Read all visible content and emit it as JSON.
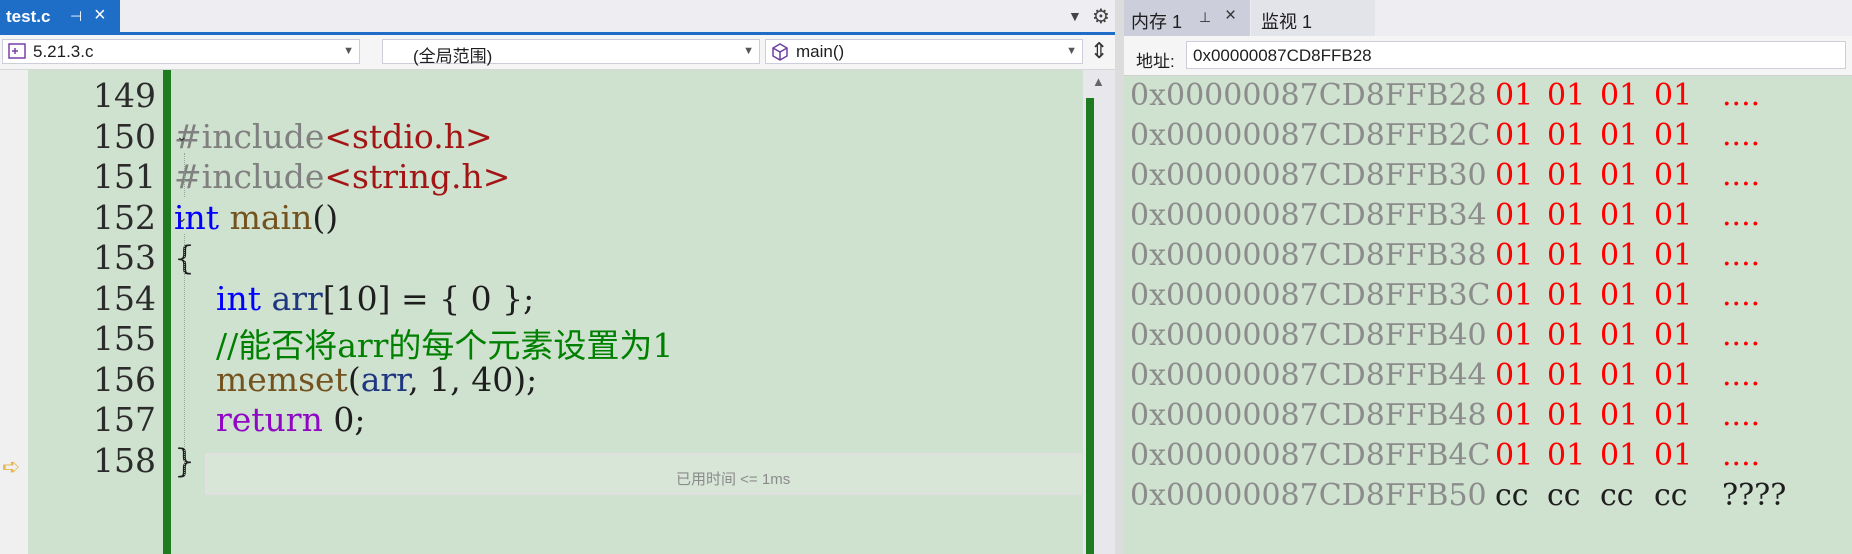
{
  "editor": {
    "tab": {
      "title": "test.c"
    },
    "nav": {
      "project": "5.21.3.c",
      "scope": "(全局范围)",
      "member": "main()"
    },
    "lines": [
      {
        "num": "149",
        "parts": []
      },
      {
        "num": "150",
        "parts": [
          {
            "t": "#include",
            "c": "pp"
          },
          {
            "t": "<stdio.h>",
            "c": "inc"
          }
        ]
      },
      {
        "num": "151",
        "parts": [
          {
            "t": "#include",
            "c": "pp"
          },
          {
            "t": "<string.h>",
            "c": "inc"
          }
        ]
      },
      {
        "num": "152",
        "parts": [
          {
            "t": "int",
            "c": "kw"
          },
          {
            "t": " ",
            "c": ""
          },
          {
            "t": "main",
            "c": "fn"
          },
          {
            "t": "()",
            "c": ""
          }
        ]
      },
      {
        "num": "153",
        "parts": [
          {
            "t": "{",
            "c": ""
          }
        ]
      },
      {
        "num": "154",
        "parts": [
          {
            "t": "    ",
            "c": ""
          },
          {
            "t": "int",
            "c": "kw"
          },
          {
            "t": " ",
            "c": ""
          },
          {
            "t": "arr",
            "c": "var"
          },
          {
            "t": "[10] = { 0 };",
            "c": ""
          }
        ]
      },
      {
        "num": "155",
        "parts": [
          {
            "t": "    ",
            "c": ""
          },
          {
            "t": "//能否将arr的每个元素设置为1",
            "c": "cmt"
          }
        ]
      },
      {
        "num": "156",
        "parts": [
          {
            "t": "    ",
            "c": ""
          },
          {
            "t": "memset",
            "c": "fn"
          },
          {
            "t": "(",
            "c": ""
          },
          {
            "t": "arr",
            "c": "var"
          },
          {
            "t": ", 1, 40);",
            "c": ""
          }
        ]
      },
      {
        "num": "157",
        "parts": [
          {
            "t": "    ",
            "c": ""
          },
          {
            "t": "return",
            "c": "kw-ctrl"
          },
          {
            "t": " 0;",
            "c": ""
          }
        ]
      },
      {
        "num": "158",
        "parts": [
          {
            "t": "}",
            "c": ""
          }
        ]
      }
    ],
    "elapsed": "已用时间 <= 1ms"
  },
  "memory": {
    "tab1": "内存 1",
    "tab2": "监视 1",
    "address_label": "地址:",
    "address_value": "0x00000087CD8FFB28",
    "rows": [
      {
        "addr": "0x00000087CD8FFB28",
        "bytes": [
          "01",
          "01",
          "01",
          "01"
        ],
        "ascii": "....",
        "changed": true
      },
      {
        "addr": "0x00000087CD8FFB2C",
        "bytes": [
          "01",
          "01",
          "01",
          "01"
        ],
        "ascii": "....",
        "changed": true
      },
      {
        "addr": "0x00000087CD8FFB30",
        "bytes": [
          "01",
          "01",
          "01",
          "01"
        ],
        "ascii": "....",
        "changed": true
      },
      {
        "addr": "0x00000087CD8FFB34",
        "bytes": [
          "01",
          "01",
          "01",
          "01"
        ],
        "ascii": "....",
        "changed": true
      },
      {
        "addr": "0x00000087CD8FFB38",
        "bytes": [
          "01",
          "01",
          "01",
          "01"
        ],
        "ascii": "....",
        "changed": true
      },
      {
        "addr": "0x00000087CD8FFB3C",
        "bytes": [
          "01",
          "01",
          "01",
          "01"
        ],
        "ascii": "....",
        "changed": true
      },
      {
        "addr": "0x00000087CD8FFB40",
        "bytes": [
          "01",
          "01",
          "01",
          "01"
        ],
        "ascii": "....",
        "changed": true
      },
      {
        "addr": "0x00000087CD8FFB44",
        "bytes": [
          "01",
          "01",
          "01",
          "01"
        ],
        "ascii": "....",
        "changed": true
      },
      {
        "addr": "0x00000087CD8FFB48",
        "bytes": [
          "01",
          "01",
          "01",
          "01"
        ],
        "ascii": "....",
        "changed": true
      },
      {
        "addr": "0x00000087CD8FFB4C",
        "bytes": [
          "01",
          "01",
          "01",
          "01"
        ],
        "ascii": "....",
        "changed": true
      },
      {
        "addr": "0x00000087CD8FFB50",
        "bytes": [
          "cc",
          "cc",
          "cc",
          "cc"
        ],
        "ascii": "????",
        "changed": false
      }
    ]
  }
}
